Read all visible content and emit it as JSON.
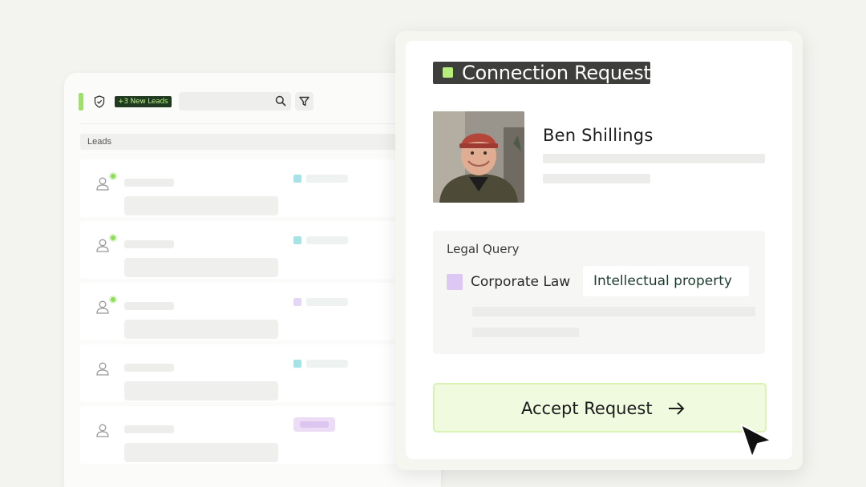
{
  "leads_panel": {
    "new_leads_badge": "+3 New Leads",
    "header_label": "Leads",
    "search": {
      "placeholder": ""
    },
    "rows": [
      {
        "online": true,
        "tag_color": "#a6e3e6",
        "tag_style": "square"
      },
      {
        "online": true,
        "tag_color": "#a6e3e6",
        "tag_style": "square"
      },
      {
        "online": true,
        "tag_color": "#e6d6f5",
        "tag_style": "square"
      },
      {
        "online": false,
        "tag_color": "#a6e3e6",
        "tag_style": "square"
      },
      {
        "online": false,
        "tag_color": "#ecdcf6",
        "tag_style": "pill"
      }
    ]
  },
  "card": {
    "title": "Connection Request",
    "person_name": "Ben Shillings",
    "query_label": "Legal Query",
    "practice_area": "Corporate Law",
    "topic": "Intellectual property",
    "accept_label": "Accept Request"
  },
  "colors": {
    "accent_green": "#b7ed7d",
    "accept_bg": "#effadf",
    "title_chip_bg": "#3e3e3c",
    "purple": "#ddc7f3",
    "badge_bg": "#1f3a20"
  },
  "icons": [
    "shield-icon",
    "search-icon",
    "filter-icon",
    "user-icon",
    "arrow-right-icon",
    "cursor-icon"
  ]
}
